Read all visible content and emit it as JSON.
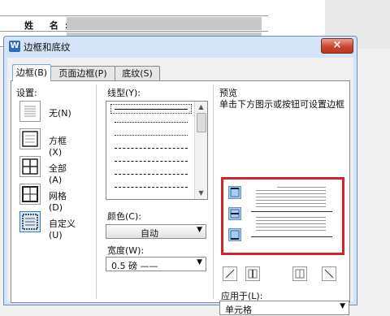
{
  "background_doc": {
    "name_label": "姓  名:"
  },
  "dialog": {
    "title": "边框和底纹",
    "close_symbol": "×",
    "tabs": [
      {
        "label": "边框(B)",
        "active": true
      },
      {
        "label": "页面边框(P)",
        "active": false
      },
      {
        "label": "底纹(S)",
        "active": false
      }
    ],
    "settings": {
      "label": "设置:",
      "presets": [
        {
          "label": "无(N)",
          "icon": "none-border-icon"
        },
        {
          "label": "方框(X)",
          "icon": "box-border-icon"
        },
        {
          "label": "全部(A)",
          "icon": "all-borders-icon"
        },
        {
          "label": "网格(D)",
          "icon": "grid-border-icon"
        },
        {
          "label": "自定义(U)",
          "icon": "custom-border-icon",
          "active": true
        }
      ]
    },
    "line_style": {
      "label": "线型(Y):"
    },
    "color": {
      "label": "颜色(C):",
      "value": "自动"
    },
    "width": {
      "label": "宽度(W):",
      "value": "0.5  磅 ——"
    },
    "preview": {
      "label": "预览",
      "hint": "单击下方图示或按钮可设置边框",
      "highlight_color": "#d4222a"
    },
    "apply_to": {
      "label": "应用于(L):",
      "value": "单元格"
    }
  }
}
